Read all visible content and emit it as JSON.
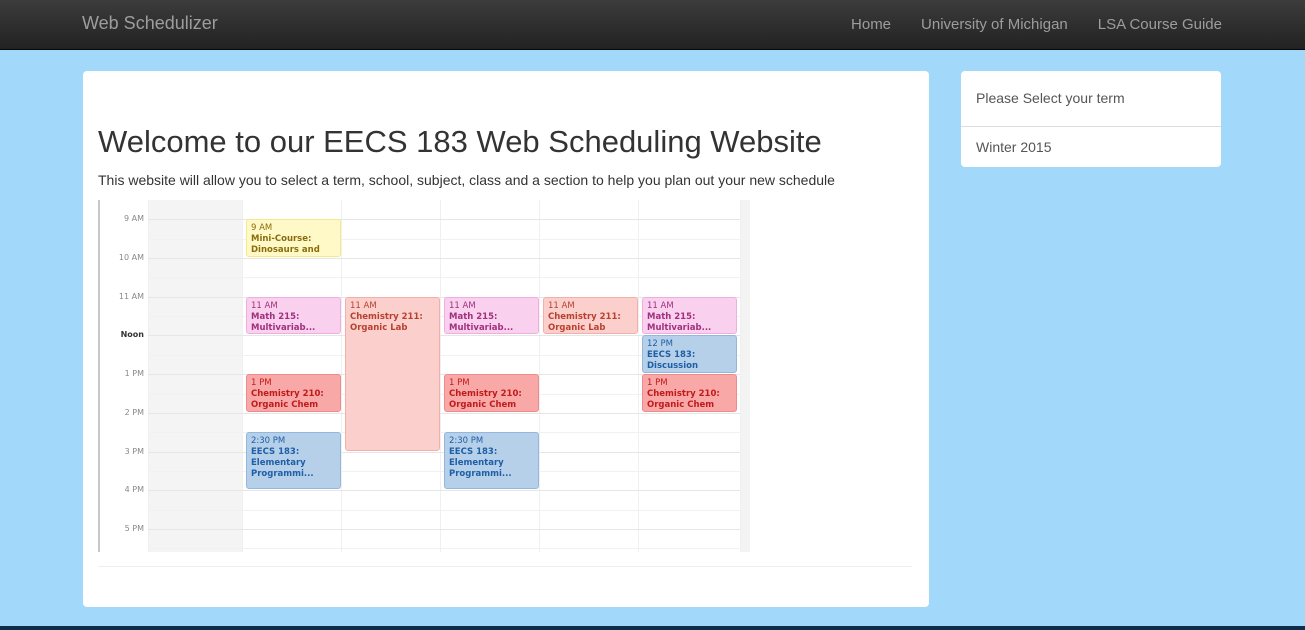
{
  "navbar": {
    "brand": "Web Schedulizer",
    "links": [
      "Home",
      "University of Michigan",
      "LSA Course Guide"
    ]
  },
  "main": {
    "heading": "Welcome to our EECS 183 Web Scheduling Website",
    "intro": "This website will allow you to select a term, school, subject, class and a section to help you plan out your new schedule"
  },
  "schedule": {
    "time_labels": [
      "9 AM",
      "10 AM",
      "11 AM",
      "Noon",
      "1 PM",
      "2 PM",
      "3 PM",
      "4 PM",
      "5 PM"
    ],
    "events": [
      {
        "day": 0,
        "start": 9.0,
        "end": 10.0,
        "time": "9 AM",
        "title": "Mini-Course:",
        "title2": "Dinosaurs and oth...",
        "color": "yellow"
      },
      {
        "day": 0,
        "start": 11.0,
        "end": 12.0,
        "time": "11 AM",
        "title": "Math 215:",
        "title2": "Multivariab...",
        "color": "pink"
      },
      {
        "day": 1,
        "start": 11.0,
        "end": 15.0,
        "time": "11 AM",
        "title": "Chemistry 211:",
        "title2": "Organic Lab",
        "color": "salmon"
      },
      {
        "day": 2,
        "start": 11.0,
        "end": 12.0,
        "time": "11 AM",
        "title": "Math 215:",
        "title2": "Multivariab...",
        "color": "pink"
      },
      {
        "day": 3,
        "start": 11.0,
        "end": 12.0,
        "time": "11 AM",
        "title": "Chemistry 211:",
        "title2": "Organic Lab",
        "color": "salmon"
      },
      {
        "day": 4,
        "start": 11.0,
        "end": 12.0,
        "time": "11 AM",
        "title": "Math 215:",
        "title2": "Multivariab...",
        "color": "pink"
      },
      {
        "day": 4,
        "start": 12.0,
        "end": 13.0,
        "time": "12 PM",
        "title": "EECS 183:",
        "title2": "Discussion",
        "color": "blue"
      },
      {
        "day": 0,
        "start": 13.0,
        "end": 14.0,
        "time": "1 PM",
        "title": "Chemistry 210:",
        "title2": "Organic Chem",
        "color": "red"
      },
      {
        "day": 2,
        "start": 13.0,
        "end": 14.0,
        "time": "1 PM",
        "title": "Chemistry 210:",
        "title2": "Organic Chem",
        "color": "red"
      },
      {
        "day": 4,
        "start": 13.0,
        "end": 14.0,
        "time": "1 PM",
        "title": "Chemistry 210:",
        "title2": "Organic Chem",
        "color": "red"
      },
      {
        "day": 0,
        "start": 14.5,
        "end": 16.0,
        "time": "2:30 PM",
        "title": "EECS 183:",
        "title2": "Elementary",
        "title3": "Programmi...",
        "color": "blue"
      },
      {
        "day": 2,
        "start": 14.5,
        "end": 16.0,
        "time": "2:30 PM",
        "title": "EECS 183:",
        "title2": "Elementary",
        "title3": "Programmi...",
        "color": "blue"
      }
    ],
    "colors": {
      "yellow": {
        "bg": "#fff9c8",
        "border": "#f6e98a",
        "text": "#8a6d0b"
      },
      "pink": {
        "bg": "#fad0ef",
        "border": "#f0aee0",
        "text": "#a0307d"
      },
      "salmon": {
        "bg": "#fbd0cc",
        "border": "#f2b0aa",
        "text": "#b84030"
      },
      "red": {
        "bg": "#f9a8a8",
        "border": "#ef8a8a",
        "text": "#c01a1a"
      },
      "blue": {
        "bg": "#b6d0ea",
        "border": "#93b7dd",
        "text": "#1e5fa6"
      }
    }
  },
  "term_panel": {
    "prompt": "Please Select your term",
    "term": "Winter 2015"
  }
}
